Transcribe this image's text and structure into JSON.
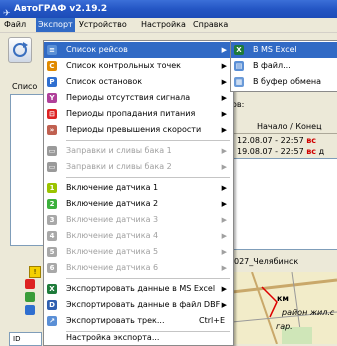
{
  "window": {
    "title": "АвтоГРАФ v2.19.2"
  },
  "menubar": {
    "items": [
      "Файл",
      "Экспорт",
      "Устройство",
      "Настройка",
      "Справка"
    ]
  },
  "left": {
    "label_partial": "Списо"
  },
  "right": {
    "label_partial": "ов:",
    "column_header": "Начало / Конец",
    "rows": [
      {
        "time": "12.08.07 - 22:57",
        "tag": "вс",
        "extra": ""
      },
      {
        "time": "19.08.07 - 22:57",
        "tag": "вс",
        "extra": "д"
      }
    ],
    "map_label": "027_Челябинск",
    "map_texts": [
      "км",
      "район жил.с",
      "гар."
    ]
  },
  "export_menu": {
    "items": [
      {
        "label": "Список рейсов",
        "icon": "trips-list-icon",
        "submenu": true,
        "highlighted": true
      },
      {
        "label": "Список контрольных точек",
        "icon": "checkpoints-icon",
        "submenu": true
      },
      {
        "label": "Список остановок",
        "icon": "stops-icon",
        "submenu": true
      },
      {
        "label": "Периоды отсутствия сигнала",
        "icon": "no-signal-icon",
        "submenu": true
      },
      {
        "label": "Периоды пропадания питания",
        "icon": "power-loss-icon",
        "submenu": true
      },
      {
        "label": "Периоды превышения скорости",
        "icon": "speeding-icon",
        "submenu": true
      },
      {
        "label": "Заправки и сливы бака 1",
        "icon": "tank1-icon",
        "submenu": true,
        "disabled": true
      },
      {
        "label": "Заправки и сливы бака 2",
        "icon": "tank2-icon",
        "submenu": true,
        "disabled": true
      },
      {
        "label": "Включение датчика 1",
        "icon": "sensor1-icon",
        "submenu": true
      },
      {
        "label": "Включение датчика 2",
        "icon": "sensor2-icon",
        "submenu": true
      },
      {
        "label": "Включение датчика 3",
        "icon": "sensor3-icon",
        "submenu": true,
        "disabled": true
      },
      {
        "label": "Включение датчика 4",
        "icon": "sensor4-icon",
        "submenu": true,
        "disabled": true
      },
      {
        "label": "Включение датчика 5",
        "icon": "sensor5-icon",
        "submenu": true,
        "disabled": true
      },
      {
        "label": "Включение датчика 6",
        "icon": "sensor6-icon",
        "submenu": true,
        "disabled": true
      },
      {
        "label": "Экспортировать данные в MS Excel",
        "icon": "excel-icon",
        "submenu": true
      },
      {
        "label": "Экспортировать данные в файл DBF",
        "icon": "dbf-icon",
        "submenu": true
      },
      {
        "label": "Экспортировать трек...",
        "icon": "track-icon",
        "shortcut": "Ctrl+E"
      },
      {
        "label": "Настройка экспорта...",
        "icon": ""
      }
    ]
  },
  "submenu": {
    "items": [
      "В MS Excel",
      "В файл...",
      "В буфер обмена"
    ]
  },
  "colors": {
    "highlight": "#316ac5",
    "title_bar": "#2456c4",
    "menu_bg": "#ffffff",
    "disabled": "#a0a0a0"
  }
}
